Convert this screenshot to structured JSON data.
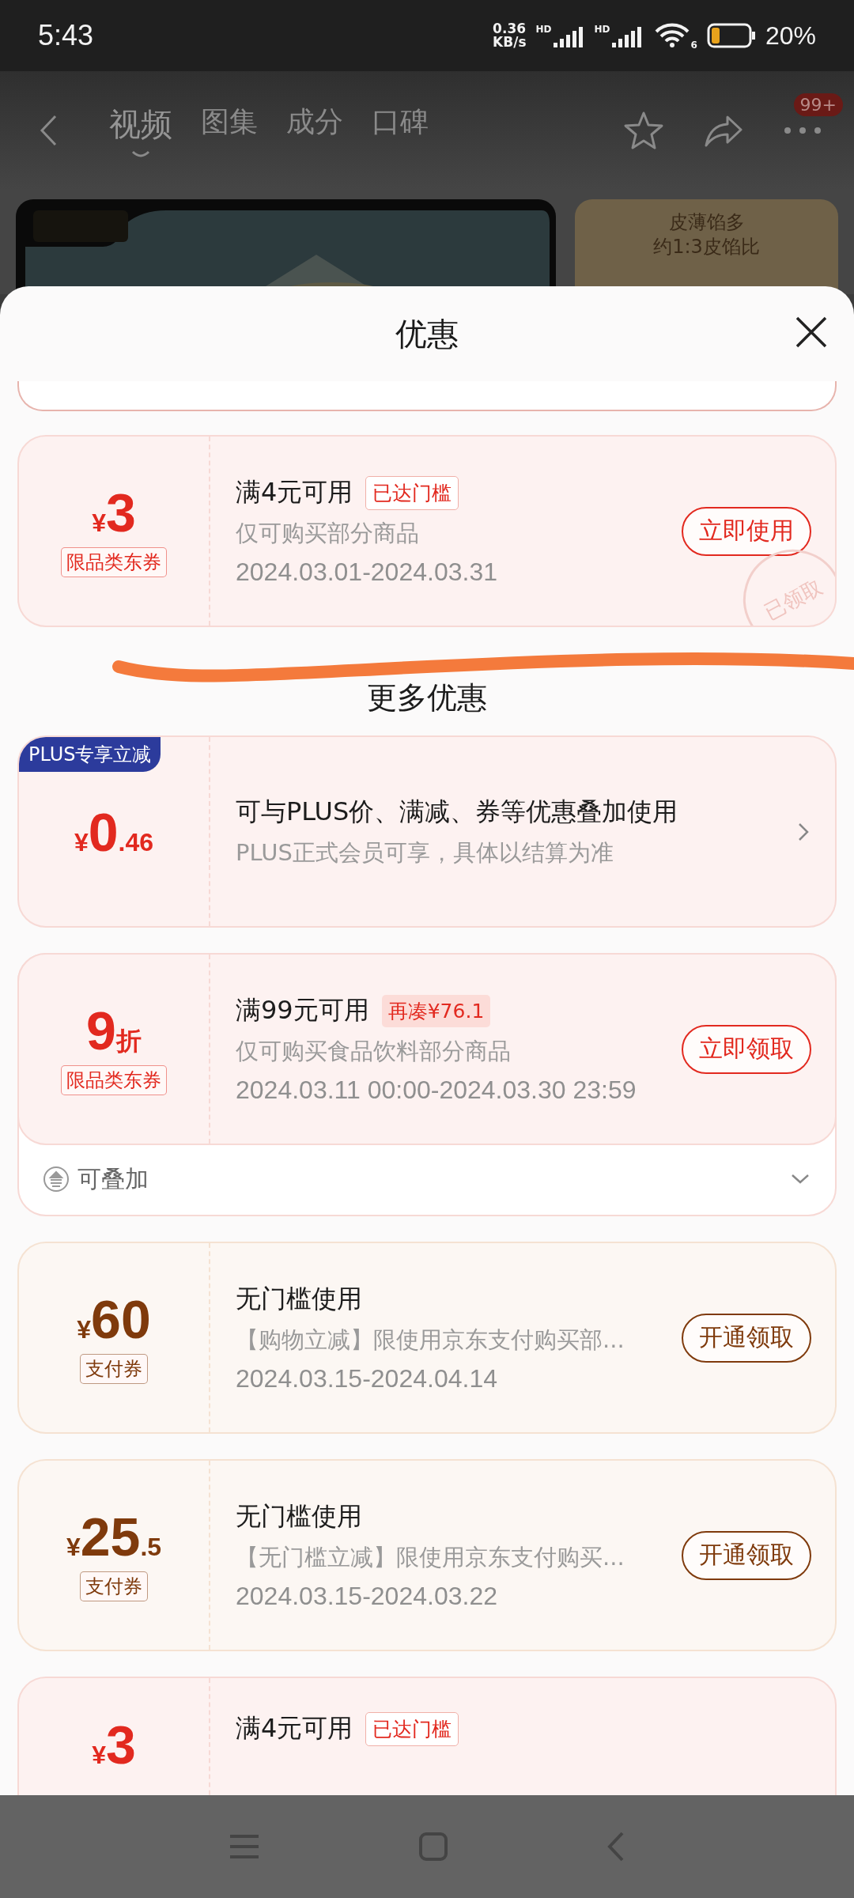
{
  "status_bar": {
    "time": "5:43",
    "speed_value": "0.36",
    "speed_unit": "KB/s",
    "signals": [
      {
        "label": "HD"
      },
      {
        "label": "HD"
      }
    ],
    "wifi_label": "6",
    "battery": "20%"
  },
  "header": {
    "tabs": [
      {
        "label": "视频",
        "selected": true
      },
      {
        "label": "图集",
        "selected": false
      },
      {
        "label": "成分",
        "selected": false
      },
      {
        "label": "口碑",
        "selected": false
      }
    ],
    "badge": "99+"
  },
  "gallery": {
    "side_card": [
      "皮薄馅多",
      "约1:3皮馅比"
    ]
  },
  "sheet": {
    "title": "优惠",
    "more_title": "更多优惠",
    "coupons": [
      {
        "kind": "category",
        "currency": "¥",
        "integer": "3",
        "label": "限品类东券",
        "title": "满4元可用",
        "tag": {
          "kind": "met",
          "text": "已达门槛"
        },
        "desc": "仅可购买部分商品",
        "date": "2024.03.01-2024.03.31",
        "button": "立即使用",
        "stamp": "已领取"
      }
    ],
    "more": [
      {
        "kind": "plus",
        "badge": "PLUS专享立减",
        "currency": "¥",
        "integer": "0",
        "decimal": ".46",
        "title": "可与PLUS价、满减、券等优惠叠加使用",
        "desc": "PLUS正式会员可享，具体以结算为准"
      },
      {
        "kind": "category",
        "integer": "9",
        "unit": "折",
        "label": "限品类东券",
        "title": "满99元可用",
        "tag": {
          "kind": "short",
          "text": "再凑¥76.1"
        },
        "desc": "仅可购买食品饮料部分商品",
        "date": "2024.03.11 00:00-2024.03.30 23:59",
        "button": "立即领取",
        "footer": "可叠加"
      },
      {
        "kind": "payment",
        "currency": "¥",
        "integer": "60",
        "label": "支付券",
        "title": "无门槛使用",
        "desc": "【购物立减】限使用京东支付购买部...",
        "date": "2024.03.15-2024.04.14",
        "button": "开通领取"
      },
      {
        "kind": "payment",
        "currency": "¥",
        "integer": "25",
        "decimal": ".5",
        "label": "支付券",
        "title": "无门槛使用",
        "desc": "【无门槛立减】限使用京东支付购买...",
        "date": "2024.03.15-2024.03.22",
        "button": "开通领取"
      },
      {
        "kind": "category",
        "currency": "¥",
        "integer": "3",
        "title": "满4元可用",
        "tag": {
          "kind": "met",
          "text": "已达门槛"
        }
      }
    ]
  }
}
